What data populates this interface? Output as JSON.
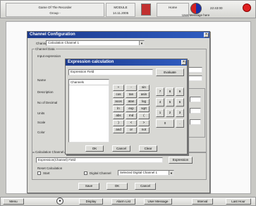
{
  "top": {
    "title_line1": "Game Of The Recorder",
    "title_line2": "Group -",
    "module_line1": "MODULE",
    "module_line2": "14.11.2005",
    "home_label": "Home",
    "status_label": "22:43:00",
    "message_label": "User Message here"
  },
  "main": {
    "title": "Channel Configuration",
    "channel_label": "Channel",
    "channel_value": "Calculation Channel 1",
    "section_label": "Channel Data",
    "field_labels": [
      "Name",
      "Description",
      "No of Decimal",
      "Units",
      "Scale",
      "Color"
    ],
    "field_label_top": "Input expression",
    "expr_section_label": "Calculation Channel",
    "expr_value": "Expression(Channel) Field",
    "expression_btn": "Expression",
    "reset_label": "Reset Calculation",
    "reset_opt_start": "Start",
    "digital_label": "Digital Channel",
    "digital_select": "Selected Digital Channel 1",
    "buttons": [
      "Save",
      "OK",
      "Cancel"
    ]
  },
  "dialog": {
    "title": "Expression calculation",
    "expr_field": "Expression Field",
    "evaluate_btn": "Evaluate",
    "list_header": "Channels",
    "func_keys": [
      "+",
      "-",
      "sin",
      "cos",
      "tan",
      "asin",
      "acos",
      "atan",
      "log",
      "ln",
      "exp",
      "sqrt",
      "abs",
      "rnd",
      "(",
      ")",
      "<",
      ">",
      "and",
      "or",
      "not"
    ],
    "num_keys": [
      "7",
      "8",
      "9",
      "4",
      "5",
      "6",
      "1",
      "2",
      "3",
      "0",
      "."
    ],
    "buttons": [
      "OK",
      "Cancel",
      "Clear"
    ]
  },
  "bottom": {
    "items": [
      "Menu",
      "Display",
      "Alarm List",
      "User Message",
      "Interval",
      "Last Hour"
    ]
  },
  "colors": {
    "title_bar": "#2f5cc0",
    "window": "#d8d8d4",
    "accent_red": "#d62020"
  }
}
